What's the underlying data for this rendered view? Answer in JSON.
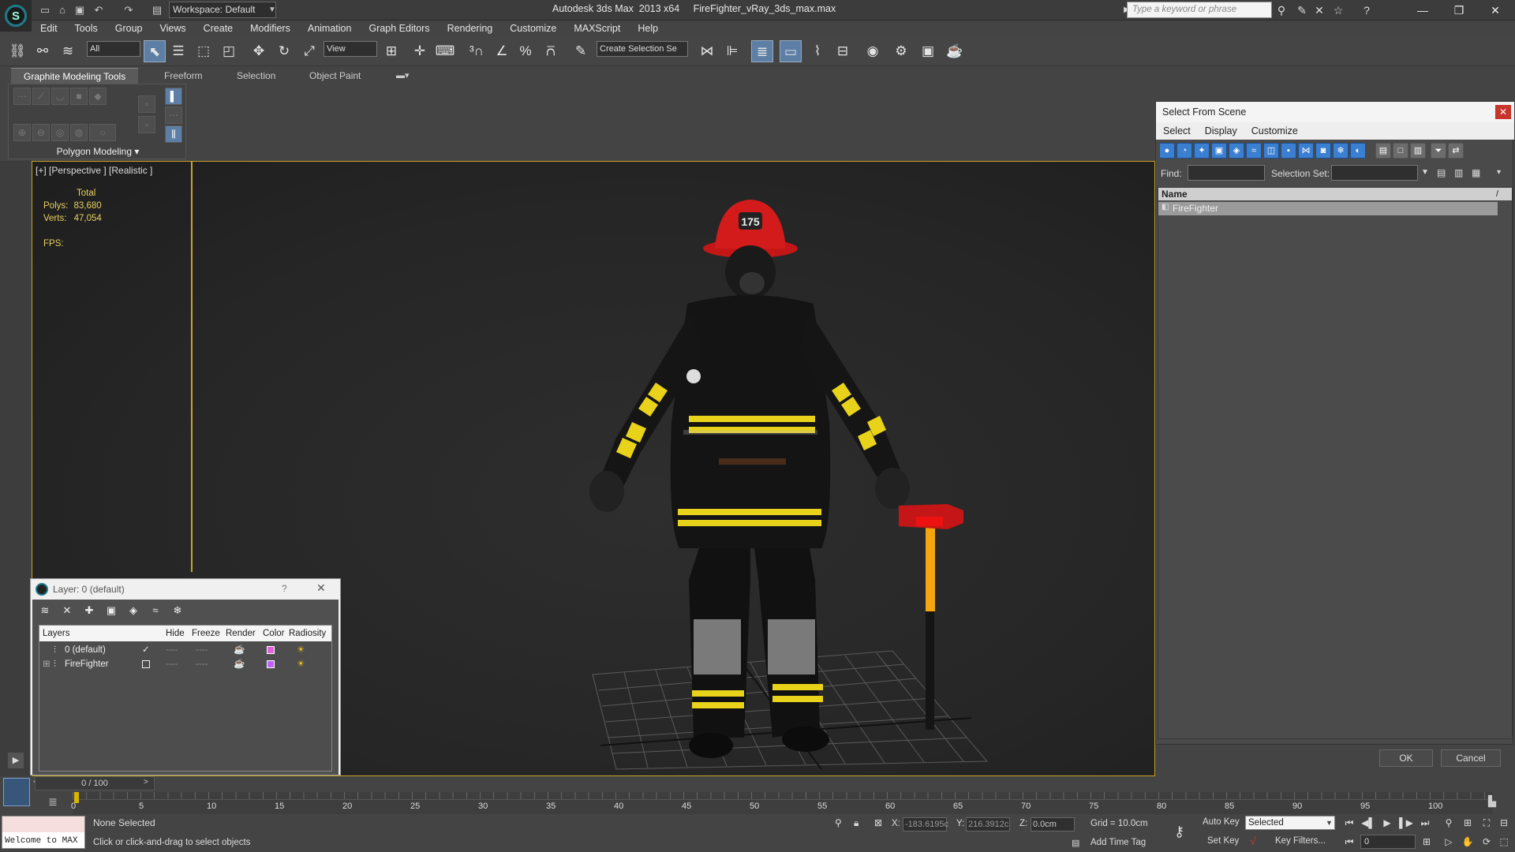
{
  "window": {
    "title": "Autodesk 3ds Max  2013 x64     FireFighter_vRay_3ds_max.max",
    "workspace": "Workspace: Default",
    "search_placeholder": "Type a keyword or phrase"
  },
  "menu": [
    "Edit",
    "Tools",
    "Group",
    "Views",
    "Create",
    "Modifiers",
    "Animation",
    "Graph Editors",
    "Rendering",
    "Customize",
    "MAXScript",
    "Help"
  ],
  "toolbar": {
    "selection_filter": "All",
    "ref_coord": "View",
    "named_selection_placeholder": "Create Selection Se"
  },
  "ribbon": {
    "tabs": [
      "Graphite Modeling Tools",
      "Freeform",
      "Selection",
      "Object Paint"
    ],
    "panel_label": "Polygon Modeling ▾"
  },
  "viewport": {
    "label": "[+] [Perspective ] [Realistic ]",
    "stats_total": "Total",
    "polys_label": "Polys:",
    "polys_value": "83,680",
    "verts_label": "Verts:",
    "verts_value": "47,054",
    "fps_label": "FPS:"
  },
  "select_from_scene": {
    "title": "Select From Scene",
    "menu": [
      "Select",
      "Display",
      "Customize"
    ],
    "find_label": "Find:",
    "selection_set_label": "Selection Set:",
    "column_name": "Name",
    "rows": [
      "FireFighter"
    ],
    "ok": "OK",
    "cancel": "Cancel"
  },
  "layer_manager": {
    "title": "Layer: 0 (default)",
    "help": "?",
    "columns": [
      "Layers",
      "Hide",
      "Freeze",
      "Render",
      "Color",
      "Radiosity"
    ],
    "rows": [
      {
        "name": "0 (default)",
        "active_mark": "✓",
        "color": "#e060e0"
      },
      {
        "name": "FireFighter",
        "active_mark": "",
        "color": "#c060ff"
      }
    ]
  },
  "timeline": {
    "frame_slider": "0 / 100",
    "ticks": [
      "0",
      "5",
      "10",
      "15",
      "20",
      "25",
      "30",
      "35",
      "40",
      "45",
      "50",
      "55",
      "60",
      "65",
      "70",
      "75",
      "80",
      "85",
      "90",
      "95",
      "100"
    ]
  },
  "status": {
    "maxscript_text": "Welcome to MAX",
    "selection": "None Selected",
    "prompt": "Click or click-and-drag to select objects",
    "x_label": "X:",
    "x_value": "-183.6195c",
    "y_label": "Y:",
    "y_value": "216.3912c",
    "z_label": "Z:",
    "z_value": "0.0cm",
    "grid": "Grid = 10.0cm",
    "add_time_tag": "Add Time Tag",
    "auto_key": "Auto Key",
    "selected_dropdown": "Selected",
    "set_key": "Set Key",
    "key_filters": "Key Filters...",
    "current_frame": "0"
  },
  "colors": {
    "accent_blue": "#3b7fd1",
    "viewport_border": "#c9a227",
    "stats_text": "#e8d060",
    "helmet_red": "#d31b1b",
    "stripe_yellow": "#e8d21a"
  },
  "icons": {
    "app": "3ds-max-logo-icon",
    "viewport_subject": "firefighter-model"
  }
}
